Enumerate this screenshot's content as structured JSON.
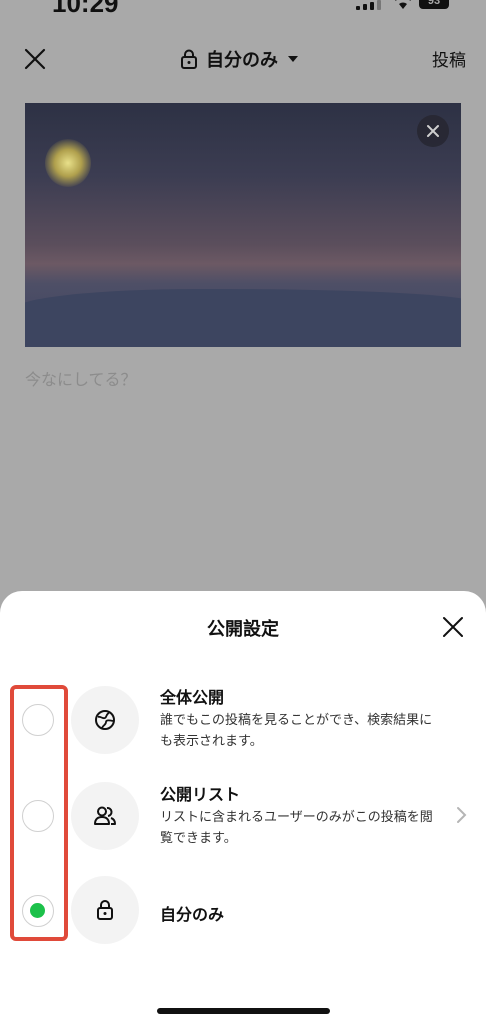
{
  "status_bar": {
    "time": "10:29",
    "battery": "93"
  },
  "composer": {
    "privacy_label": "自分のみ",
    "post_label": "投稿",
    "placeholder": "今なにしてる？"
  },
  "sheet": {
    "title": "公開設定",
    "options": [
      {
        "title": "全体公開",
        "description": "誰でもこの投稿を見ることができ、検索結果にも表示されます。",
        "icon": "globe-icon",
        "selected": false
      },
      {
        "title": "公開リスト",
        "description": "リストに含まれるユーザーのみがこの投稿を閲覧できます。",
        "icon": "people-icon",
        "selected": false,
        "has_chevron": true
      },
      {
        "title": "自分のみ",
        "description": "",
        "icon": "lock-icon",
        "selected": true
      }
    ]
  },
  "colors": {
    "accent_green": "#1cc14a",
    "highlight_red": "#e04a3a",
    "dim_overlay": "#a9a9a9"
  }
}
